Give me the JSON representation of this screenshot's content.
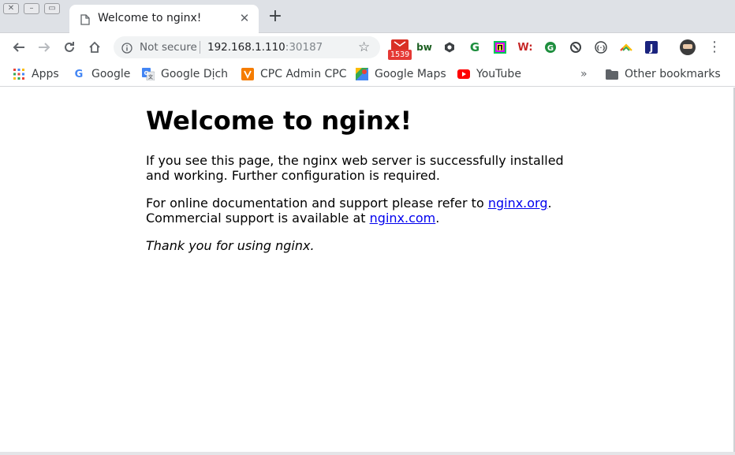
{
  "window": {
    "controls": [
      "close",
      "minimize",
      "maximize"
    ]
  },
  "tab": {
    "title": "Welcome to nginx!",
    "favicon": "page-icon"
  },
  "toolbar": {
    "security_label": "Not secure",
    "url_host": "192.168.1.110",
    "url_port": ":30187",
    "extension_badge": "1539"
  },
  "bookmarks": {
    "items": [
      {
        "label": "Apps",
        "icon": "apps-grid-icon"
      },
      {
        "label": "Google",
        "icon": "google-icon"
      },
      {
        "label": "Google Dịch",
        "icon": "google-translate-icon"
      },
      {
        "label": "CPC Admin CPC",
        "icon": "cpc-icon"
      },
      {
        "label": "Google Maps",
        "icon": "google-maps-icon"
      },
      {
        "label": "YouTube",
        "icon": "youtube-icon"
      }
    ],
    "overflow": "»",
    "other": "Other bookmarks"
  },
  "page": {
    "heading": "Welcome to nginx!",
    "para1": "If you see this page, the nginx web server is successfully installed and working. Further configuration is required.",
    "para2_prefix": "For online documentation and support please refer to ",
    "link1": "nginx.org",
    "para2_mid": ".",
    "para2_line2": "Commercial support is available at ",
    "link2": "nginx.com",
    "para2_suffix": ".",
    "para3": "Thank you for using nginx."
  },
  "colors": {
    "link": "#0000ee",
    "tabstrip": "#dee1e6",
    "omnibox": "#f1f3f4",
    "badge": "#e53935"
  }
}
